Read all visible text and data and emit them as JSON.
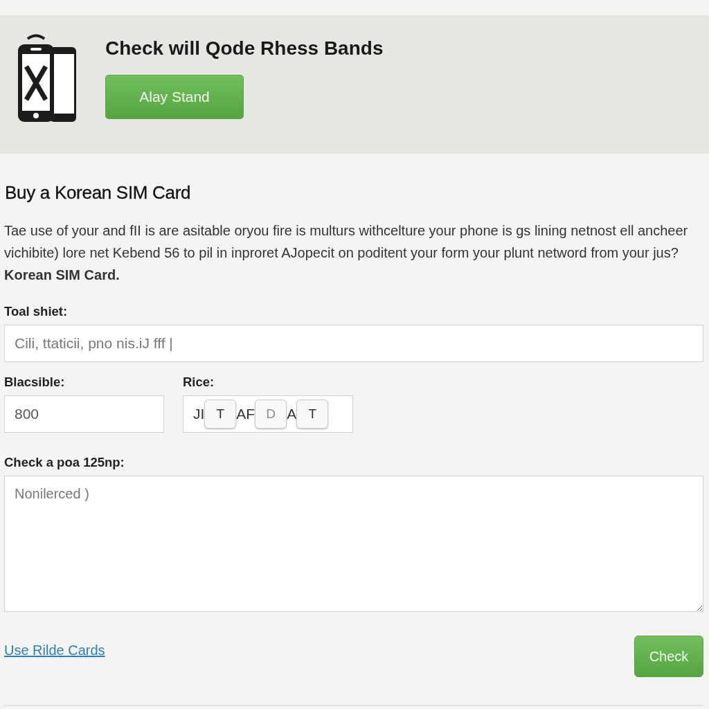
{
  "header": {
    "title": "Check will Qode Rhess Bands",
    "button": "Alay Stand"
  },
  "section": {
    "heading": "Buy a Korean SIM Card",
    "intro": "Tae use of your and fII is are asitable oryou fire is multurs withcelture your phone is gs lining netnost ell ancheer vichibite) lore net Kebend 56 to pil in inproret AJopecit on poditent your form your plunt netword from your jus? **Korean SIM Card.**"
  },
  "fields": [
    {
      "kind": "text",
      "label": "Toal shiet:",
      "placeholder": "Cili, ttaticii, pno nis.iJ fff |"
    },
    {
      "kind": "text",
      "label": "Blacsible:",
      "value": "800"
    },
    {
      "kind": "tokens",
      "label": "Rice:",
      "tokens": [
        {
          "kind": "text",
          "text": "JI"
        },
        {
          "kind": "chip",
          "text": "T",
          "faint": false
        },
        {
          "kind": "text",
          "text": "AF"
        },
        {
          "kind": "chip",
          "text": "D",
          "faint": true
        },
        {
          "kind": "text",
          "text": "A"
        },
        {
          "kind": "chip",
          "text": "T",
          "faint": false
        }
      ]
    },
    {
      "kind": "textarea",
      "label": "Check a poa 125np:",
      "placeholder": "Nonilerced )"
    }
  ],
  "footer": {
    "link": "Use Rilde Cards",
    "button": "Check"
  }
}
